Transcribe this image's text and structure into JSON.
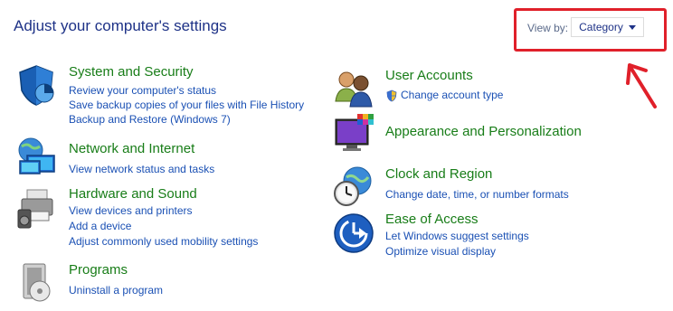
{
  "header": {
    "title": "Adjust your computer's settings",
    "view_by_label": "View by:",
    "view_by_value": "Category"
  },
  "categories": {
    "system": {
      "title": "System and Security",
      "links": [
        "Review your computer's status",
        "Save backup copies of your files with File History",
        "Backup and Restore (Windows 7)"
      ]
    },
    "network": {
      "title": "Network and Internet",
      "links": [
        "View network status and tasks"
      ]
    },
    "hardware": {
      "title": "Hardware and Sound",
      "links": [
        "View devices and printers",
        "Add a device",
        "Adjust commonly used mobility settings"
      ]
    },
    "programs": {
      "title": "Programs",
      "links": [
        "Uninstall a program"
      ]
    },
    "users": {
      "title": "User Accounts",
      "links": [
        "Change account type"
      ]
    },
    "appearance": {
      "title": "Appearance and Personalization",
      "links": []
    },
    "clock": {
      "title": "Clock and Region",
      "links": [
        "Change date, time, or number formats"
      ]
    },
    "ease": {
      "title": "Ease of Access",
      "links": [
        "Let Windows suggest settings",
        "Optimize visual display"
      ]
    }
  },
  "colors": {
    "title": "#1e3287",
    "category_title": "#187d18",
    "link": "#1a50b4",
    "highlight": "#e0202a"
  },
  "icons": {
    "system": "shield-icon",
    "network": "network-globe-icon",
    "hardware": "printer-speaker-icon",
    "programs": "programs-disc-icon",
    "users": "users-icon",
    "appearance": "monitor-palette-icon",
    "clock": "globe-clock-icon",
    "ease": "ease-of-access-icon"
  }
}
